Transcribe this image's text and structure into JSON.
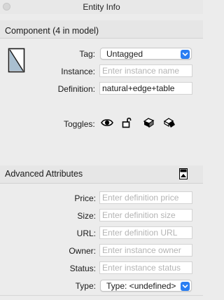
{
  "window": {
    "title": "Entity Info"
  },
  "component_section": {
    "header": "Component (4 in model)",
    "tag": {
      "label": "Tag:",
      "value": "Untagged"
    },
    "instance": {
      "label": "Instance:",
      "placeholder": "Enter instance name",
      "value": ""
    },
    "definition": {
      "label": "Definition:",
      "value": "natural+edge+table"
    },
    "toggles": {
      "label": "Toggles:",
      "icons": [
        "eye-icon",
        "lock-icon",
        "receive-shadows-icon",
        "cast-shadows-icon"
      ]
    }
  },
  "advanced_section": {
    "header": "Advanced Attributes",
    "price": {
      "label": "Price:",
      "placeholder": "Enter definition price"
    },
    "size": {
      "label": "Size:",
      "placeholder": "Enter definition size"
    },
    "url": {
      "label": "URL:",
      "placeholder": "Enter definition URL"
    },
    "owner": {
      "label": "Owner:",
      "placeholder": "Enter instance owner"
    },
    "status": {
      "label": "Status:",
      "placeholder": "Enter instance status"
    },
    "type": {
      "label": "Type:",
      "value": "Type: <undefined>"
    }
  },
  "colors": {
    "accent": "#2a7ef2",
    "background": "#ececec"
  }
}
